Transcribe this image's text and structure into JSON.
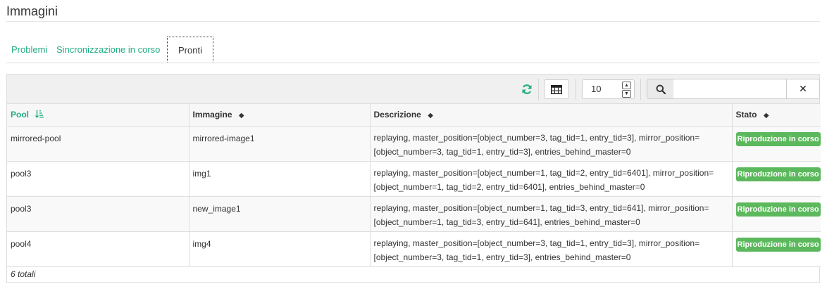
{
  "page": {
    "title": "Immagini"
  },
  "tabs": [
    {
      "label": "Problemi",
      "active": false
    },
    {
      "label": "Sincronizzazione in corso",
      "active": false
    },
    {
      "label": "Pronti",
      "active": true
    }
  ],
  "toolbar": {
    "refresh_icon": "refresh-icon",
    "columns_icon": "table-columns-icon",
    "page_size": "10",
    "search_placeholder": "",
    "search_icon": "search-icon",
    "clear_icon": "close-icon",
    "accent_color": "#1fad82"
  },
  "table": {
    "columns": [
      {
        "label": "Pool",
        "sort": "sorted-asc"
      },
      {
        "label": "Immagine",
        "sort": "sortable"
      },
      {
        "label": "Descrizione",
        "sort": "sortable"
      },
      {
        "label": "Stato",
        "sort": "sortable"
      }
    ],
    "rows": [
      {
        "pool": "mirrored-pool",
        "image": "mirrored-image1",
        "desc_line1": "replaying, master_position=[object_number=3, tag_tid=1, entry_tid=3], mirror_position=",
        "desc_line2": "[object_number=3, tag_tid=1, entry_tid=3], entries_behind_master=0",
        "status": "Riproduzione in corso"
      },
      {
        "pool": "pool3",
        "image": "img1",
        "desc_line1": "replaying, master_position=[object_number=1, tag_tid=2, entry_tid=6401], mirror_position=",
        "desc_line2": "[object_number=1, tag_tid=2, entry_tid=6401], entries_behind_master=0",
        "status": "Riproduzione in corso"
      },
      {
        "pool": "pool3",
        "image": "new_image1",
        "desc_line1": "replaying, master_position=[object_number=1, tag_tid=3, entry_tid=641], mirror_position=",
        "desc_line2": "[object_number=1, tag_tid=3, entry_tid=641], entries_behind_master=0",
        "status": "Riproduzione in corso"
      },
      {
        "pool": "pool4",
        "image": "img4",
        "desc_line1": "replaying, master_position=[object_number=3, tag_tid=1, entry_tid=3], mirror_position=",
        "desc_line2": "[object_number=3, tag_tid=1, entry_tid=3], entries_behind_master=0",
        "status": "Riproduzione in corso"
      }
    ],
    "status_color": "#5cb85c",
    "footer": "6 totali"
  }
}
